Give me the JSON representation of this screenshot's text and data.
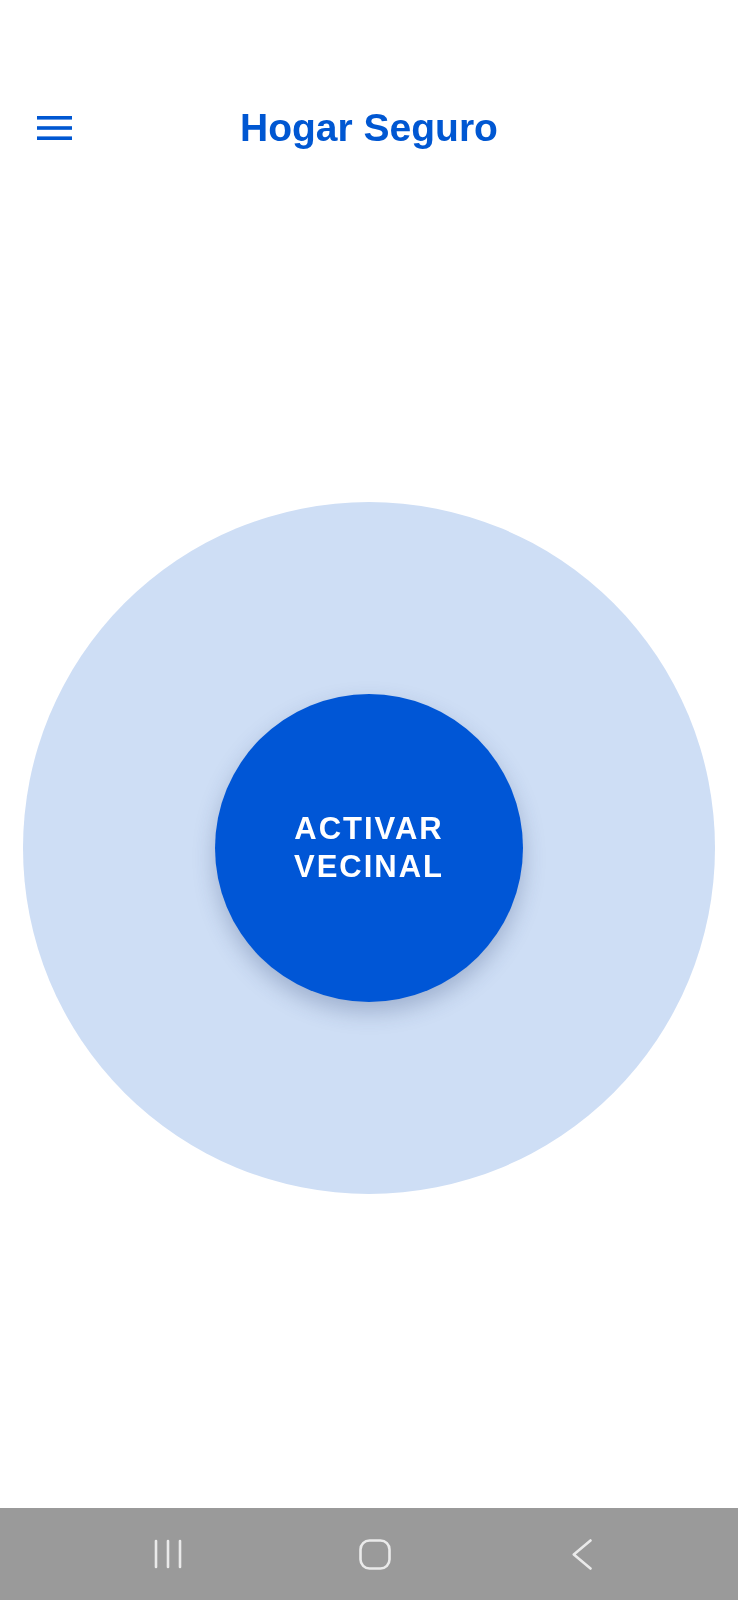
{
  "app_bar": {
    "title": "Hogar Seguro"
  },
  "main": {
    "activate_button": {
      "label": "ACTIVAR VECINAL"
    }
  }
}
